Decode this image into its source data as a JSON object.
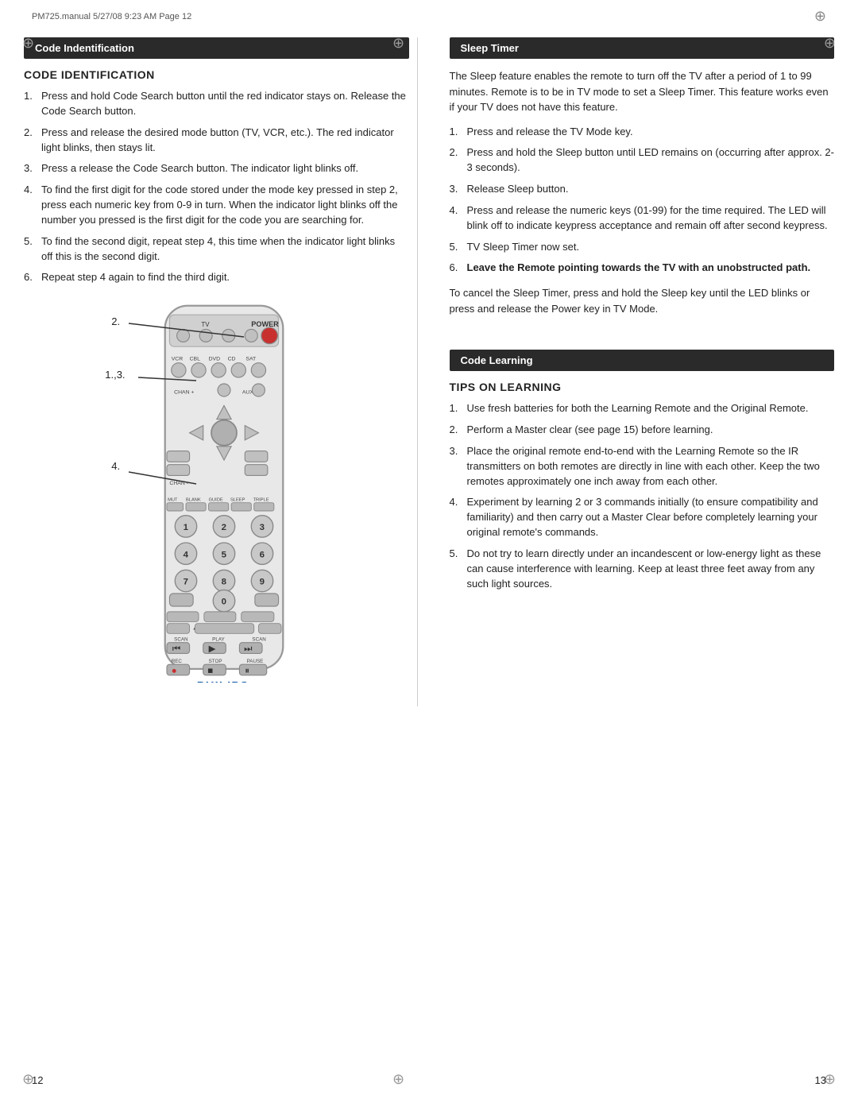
{
  "header": {
    "text": "PM725.manual  5/27/08  9:23 AM  Page 12"
  },
  "left_column": {
    "section_header": "Code Indentification",
    "section_title": "CODE IDENTIFICATION",
    "steps": [
      {
        "num": "1.",
        "text": "Press and hold Code Search button until the red indicator stays on. Release the Code Search button."
      },
      {
        "num": "2.",
        "text": "Press and release the desired mode button (TV, VCR, etc.). The red indicator light blinks, then stays lit."
      },
      {
        "num": "3.",
        "text": "Press a release the Code Search button. The indicator light blinks off."
      },
      {
        "num": "4.",
        "text": "To find the first digit for the code stored under the mode key pressed in step 2, press each numeric key from 0-9 in turn. When the indicator light blinks off the number you pressed is the first digit for the code you are searching for."
      },
      {
        "num": "5.",
        "text": "To find the second digit, repeat step 4, this time when the indicator light blinks off this is the second digit."
      },
      {
        "num": "6.",
        "text": "Repeat step 4 again to find the third digit."
      }
    ],
    "remote_labels": {
      "label_2": "2.",
      "label_13": "1.,3.",
      "label_4": "4."
    }
  },
  "right_column": {
    "sleep_timer": {
      "section_header": "Sleep Timer",
      "intro_text": "The Sleep feature enables the remote to turn off the TV after a period of 1 to 99 minutes. Remote is to be in TV mode to set a Sleep Timer. This feature works even if your TV does not have this feature.",
      "steps": [
        {
          "num": "1.",
          "text": "Press and release the TV Mode key."
        },
        {
          "num": "2.",
          "text": "Press and hold the Sleep button until LED remains on (occurring after approx. 2-3 seconds)."
        },
        {
          "num": "3.",
          "text": "Release Sleep button."
        },
        {
          "num": "4.",
          "text": "Press and release the numeric keys (01-99) for the time required. The LED will blink off to indicate keypress acceptance and remain off after second keypress."
        },
        {
          "num": "5.",
          "text": "TV Sleep Timer now set."
        },
        {
          "num": "6.",
          "text": "Leave the Remote pointing towards the TV with an unobstructed path.",
          "bold": true
        }
      ],
      "cancel_text": "To cancel the Sleep Timer, press and hold the Sleep key until the LED blinks or press and release the Power key in TV Mode."
    },
    "code_learning": {
      "section_header": "Code Learning",
      "section_title": "TIPS ON LEARNING",
      "steps": [
        {
          "num": "1.",
          "text": "Use fresh batteries for both the Learning Remote and the Original Remote."
        },
        {
          "num": "2.",
          "text": "Perform a Master clear (see page 15) before learning."
        },
        {
          "num": "3.",
          "text": "Place the original remote end-to-end with the Learning Remote so the IR transmitters on both remotes are directly in line with each other. Keep the two remotes approximately one inch away from each other."
        },
        {
          "num": "4.",
          "text": "Experiment by learning 2 or 3 commands initially (to ensure compatibility and familiarity) and then carry out a Master Clear before completely learning your original remote's commands."
        },
        {
          "num": "5.",
          "text": "Do not try to learn directly under an incandescent or low-energy light as these can cause interference with learning. Keep at least three feet away from any such light sources."
        }
      ]
    }
  },
  "page_numbers": {
    "left": "12",
    "right": "13"
  }
}
